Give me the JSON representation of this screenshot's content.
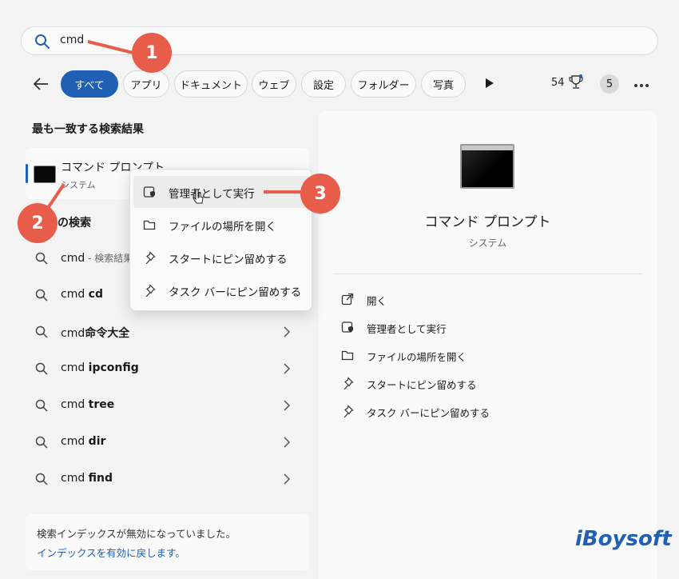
{
  "search": {
    "query": "cmd"
  },
  "filters": {
    "pills": [
      "すべて",
      "アプリ",
      "ドキュメント",
      "ウェブ",
      "設定",
      "フォルダー",
      "写真"
    ],
    "count": "54",
    "avatar_initial": "5"
  },
  "left": {
    "best_match_title": "最も一致する検索結果",
    "best_match": {
      "title": "コマンド プロンプト",
      "subtitle": "システム"
    },
    "web_section_title": "の検索",
    "results": [
      {
        "prefix": "cmd",
        "suffix": " - 検索結果"
      },
      {
        "prefix": "cmd ",
        "suffix": "cd"
      },
      {
        "prefix": "cmd",
        "suffix": "命令大全"
      },
      {
        "prefix": "cmd ",
        "suffix": "ipconfig"
      },
      {
        "prefix": "cmd ",
        "suffix": "tree"
      },
      {
        "prefix": "cmd ",
        "suffix": "dir"
      },
      {
        "prefix": "cmd ",
        "suffix": "find"
      }
    ],
    "notice": {
      "text": "検索インデックスが無効になっていました。",
      "link": "インデックスを有効に戻します。"
    }
  },
  "context_menu": {
    "items": [
      {
        "label": "管理者として実行",
        "icon": "shield-run-icon"
      },
      {
        "label": "ファイルの場所を開く",
        "icon": "folder-icon"
      },
      {
        "label": "スタートにピン留めする",
        "icon": "pin-icon"
      },
      {
        "label": "タスク バーにピン留めする",
        "icon": "pin-icon"
      }
    ]
  },
  "right": {
    "title": "コマンド プロンプト",
    "subtitle": "システム",
    "actions": [
      {
        "label": "開く",
        "icon": "open-external-icon"
      },
      {
        "label": "管理者として実行",
        "icon": "shield-run-icon"
      },
      {
        "label": "ファイルの場所を開く",
        "icon": "folder-icon"
      },
      {
        "label": "スタートにピン留めする",
        "icon": "pin-icon"
      },
      {
        "label": "タスク バーにピン留めする",
        "icon": "pin-icon"
      }
    ]
  },
  "callouts": [
    "1",
    "2",
    "3"
  ],
  "brand": "iBoysoft",
  "colors": {
    "accent": "#1f5fb4",
    "callout": "#e85c4a"
  }
}
